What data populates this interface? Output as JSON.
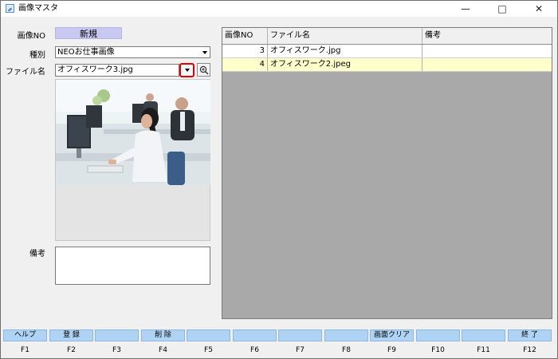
{
  "window": {
    "title": "画像マスタ",
    "controls": {
      "minimize": "—",
      "maximize": "□",
      "close": "✕"
    }
  },
  "form": {
    "image_no_label": "画像NO",
    "image_no_value": "新規",
    "type_label": "種別",
    "type_value": "NEOお仕事画像",
    "filename_label": "ファイル名",
    "filename_value": "オフィスワーク3.jpg",
    "notes_label": "備考",
    "notes_value": ""
  },
  "grid": {
    "columns": [
      "画像NO",
      "ファイル名",
      "備考"
    ],
    "rows": [
      {
        "no": "3",
        "filename": "オフィスワーク.jpg",
        "notes": ""
      },
      {
        "no": "4",
        "filename": "オフィスワーク2.jpeg",
        "notes": ""
      }
    ],
    "selected_row_color": "#ffffcc",
    "empty_area_color": "#a9a9a9"
  },
  "function_keys": [
    {
      "key": "F1",
      "label": "ヘルプ"
    },
    {
      "key": "F2",
      "label": "登 録"
    },
    {
      "key": "F3",
      "label": ""
    },
    {
      "key": "F4",
      "label": "削 除"
    },
    {
      "key": "F5",
      "label": ""
    },
    {
      "key": "F6",
      "label": ""
    },
    {
      "key": "F7",
      "label": ""
    },
    {
      "key": "F8",
      "label": ""
    },
    {
      "key": "F9",
      "label": "画面クリア"
    },
    {
      "key": "F10",
      "label": ""
    },
    {
      "key": "F11",
      "label": ""
    },
    {
      "key": "F12",
      "label": "終 了"
    }
  ],
  "colors": {
    "new_badge": "#c8c8f0",
    "function_button": "#aed3f5",
    "highlight_border": "#e00000"
  },
  "icons": {
    "dropdown": "chevron-down-icon",
    "zoom": "zoom-in-icon",
    "app": "app-icon"
  }
}
